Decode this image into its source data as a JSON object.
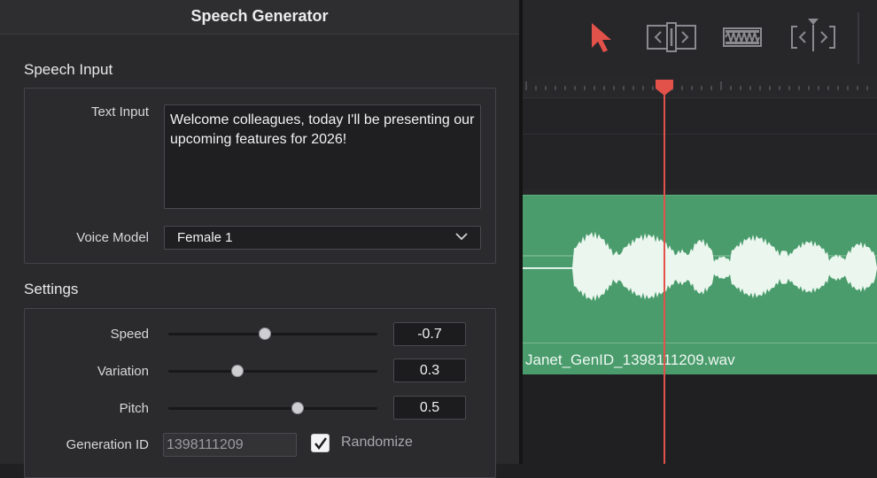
{
  "panel": {
    "title": "Speech Generator",
    "speech_input": {
      "section_title": "Speech Input",
      "text_input_label": "Text Input",
      "text_input_value": "Welcome colleagues, today I'll be presenting our upcoming features for 2026!",
      "voice_model_label": "Voice Model",
      "voice_model_value": "Female 1"
    },
    "settings": {
      "section_title": "Settings",
      "speed": {
        "label": "Speed",
        "value": "-0.7",
        "slider_fraction": 0.46
      },
      "variation": {
        "label": "Variation",
        "value": "0.3",
        "slider_fraction": 0.33
      },
      "pitch": {
        "label": "Pitch",
        "value": "0.5",
        "slider_fraction": 0.62
      },
      "generation_id": {
        "label": "Generation ID",
        "value": "1398111209"
      },
      "randomize": {
        "label": "Randomize",
        "checked": true
      }
    }
  },
  "timeline": {
    "tools": [
      "pointer-tool-icon",
      "trim-tool-icon",
      "blade-tool-icon",
      "dynamic-trim-tool-icon"
    ],
    "clip": {
      "name": "Janet_GenID_1398111209.wav",
      "color": "#4a9c6c"
    },
    "playhead_color": "#e2514a"
  }
}
